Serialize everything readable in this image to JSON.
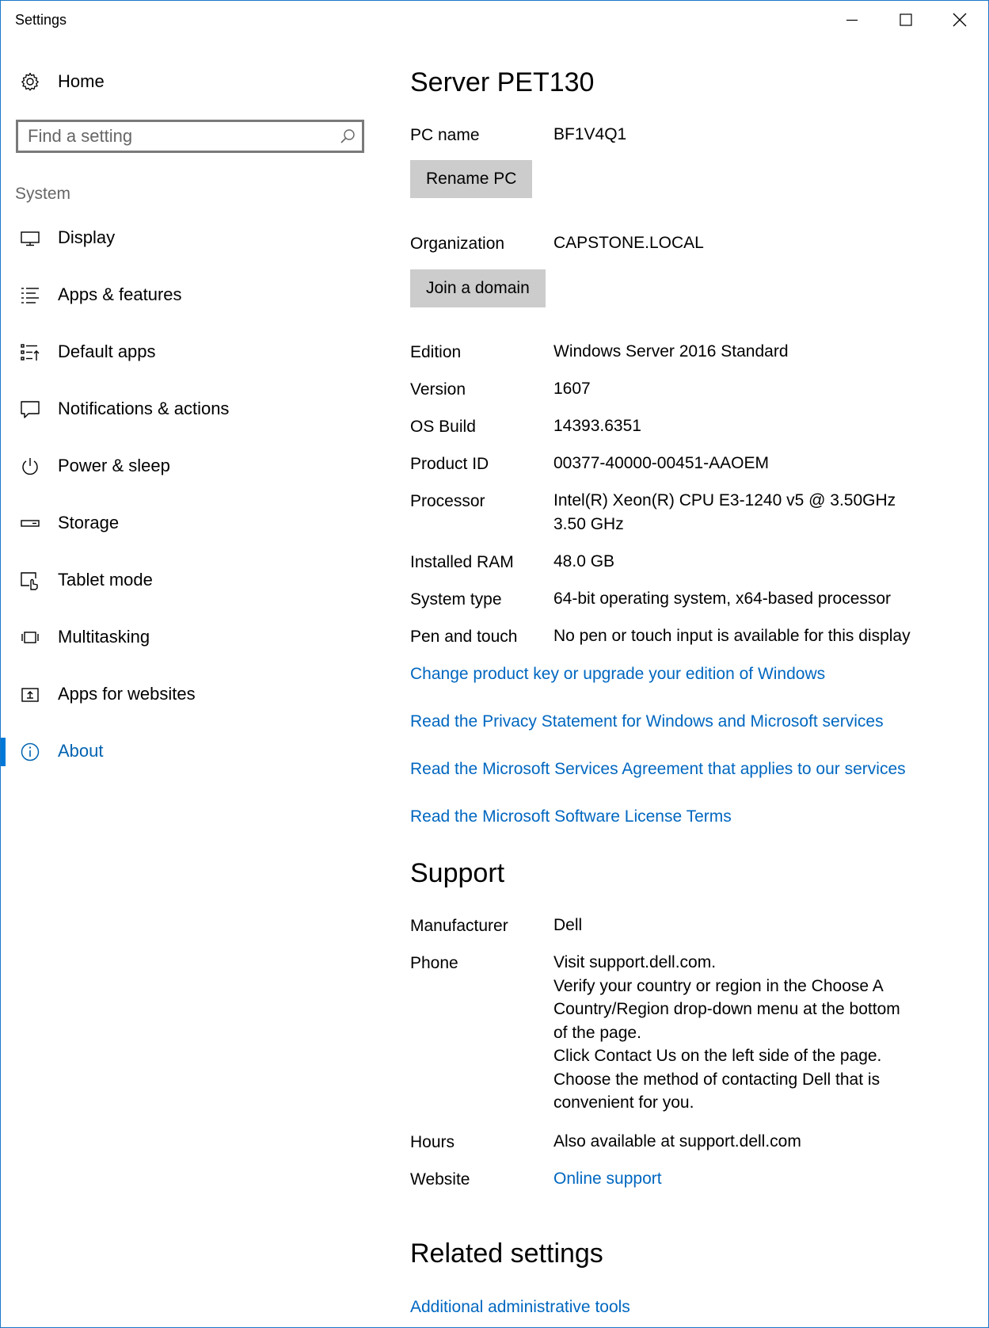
{
  "window": {
    "title": "Settings"
  },
  "sidebar": {
    "home_label": "Home",
    "search": {
      "placeholder": "Find a setting",
      "value": ""
    },
    "section_label": "System",
    "items": [
      {
        "label": "Display",
        "icon": "monitor-icon"
      },
      {
        "label": "Apps & features",
        "icon": "list-icon"
      },
      {
        "label": "Default apps",
        "icon": "default-apps-icon"
      },
      {
        "label": "Notifications & actions",
        "icon": "speech-bubble-icon"
      },
      {
        "label": "Power & sleep",
        "icon": "power-icon"
      },
      {
        "label": "Storage",
        "icon": "storage-drive-icon"
      },
      {
        "label": "Tablet mode",
        "icon": "tablet-mode-icon"
      },
      {
        "label": "Multitasking",
        "icon": "multitasking-icon"
      },
      {
        "label": "Apps for websites",
        "icon": "apps-for-websites-icon"
      },
      {
        "label": "About",
        "icon": "info-icon",
        "selected": true
      }
    ]
  },
  "main": {
    "device_title": "Server PET130",
    "pc_name": {
      "label": "PC name",
      "value": "BF1V4Q1"
    },
    "rename_button": "Rename PC",
    "organization": {
      "label": "Organization",
      "value": "CAPSTONE.LOCAL"
    },
    "join_domain_button": "Join a domain",
    "specs": [
      {
        "label": "Edition",
        "value": "Windows Server 2016 Standard"
      },
      {
        "label": "Version",
        "value": "1607"
      },
      {
        "label": "OS Build",
        "value": "14393.6351"
      },
      {
        "label": "Product ID",
        "value": "00377-40000-00451-AAOEM"
      },
      {
        "label": "Processor",
        "value_line1": "Intel(R) Xeon(R) CPU E3-1240 v5 @ 3.50GHz",
        "value_line2": "3.50 GHz"
      },
      {
        "label": "Installed RAM",
        "value": "48.0 GB"
      },
      {
        "label": "System type",
        "value": "64-bit operating system, x64-based processor"
      },
      {
        "label": "Pen and touch",
        "value": "No pen or touch input is available for this display"
      }
    ],
    "links": [
      "Change product key or upgrade your edition of Windows",
      "Read the Privacy Statement for Windows and Microsoft services",
      "Read the Microsoft Services Agreement that applies to our services",
      "Read the Microsoft Software License Terms"
    ],
    "support": {
      "heading": "Support",
      "manufacturer": {
        "label": "Manufacturer",
        "value": "Dell"
      },
      "phone": {
        "label": "Phone",
        "lines": [
          "Visit support.dell.com.",
          "Verify your country or region in the Choose A",
          "Country/Region drop-down menu at the bottom",
          "of the page.",
          "Click Contact Us on the left side of the page.",
          "Choose the method of contacting Dell that is",
          "convenient for you."
        ]
      },
      "hours": {
        "label": "Hours",
        "value": "Also available at support.dell.com"
      },
      "website": {
        "label": "Website",
        "value": "Online support"
      }
    },
    "related": {
      "heading": "Related settings",
      "link": "Additional administrative tools"
    }
  },
  "colors": {
    "accent": "#0078d7",
    "link": "#0067c0",
    "button_bg": "#cccccc"
  }
}
